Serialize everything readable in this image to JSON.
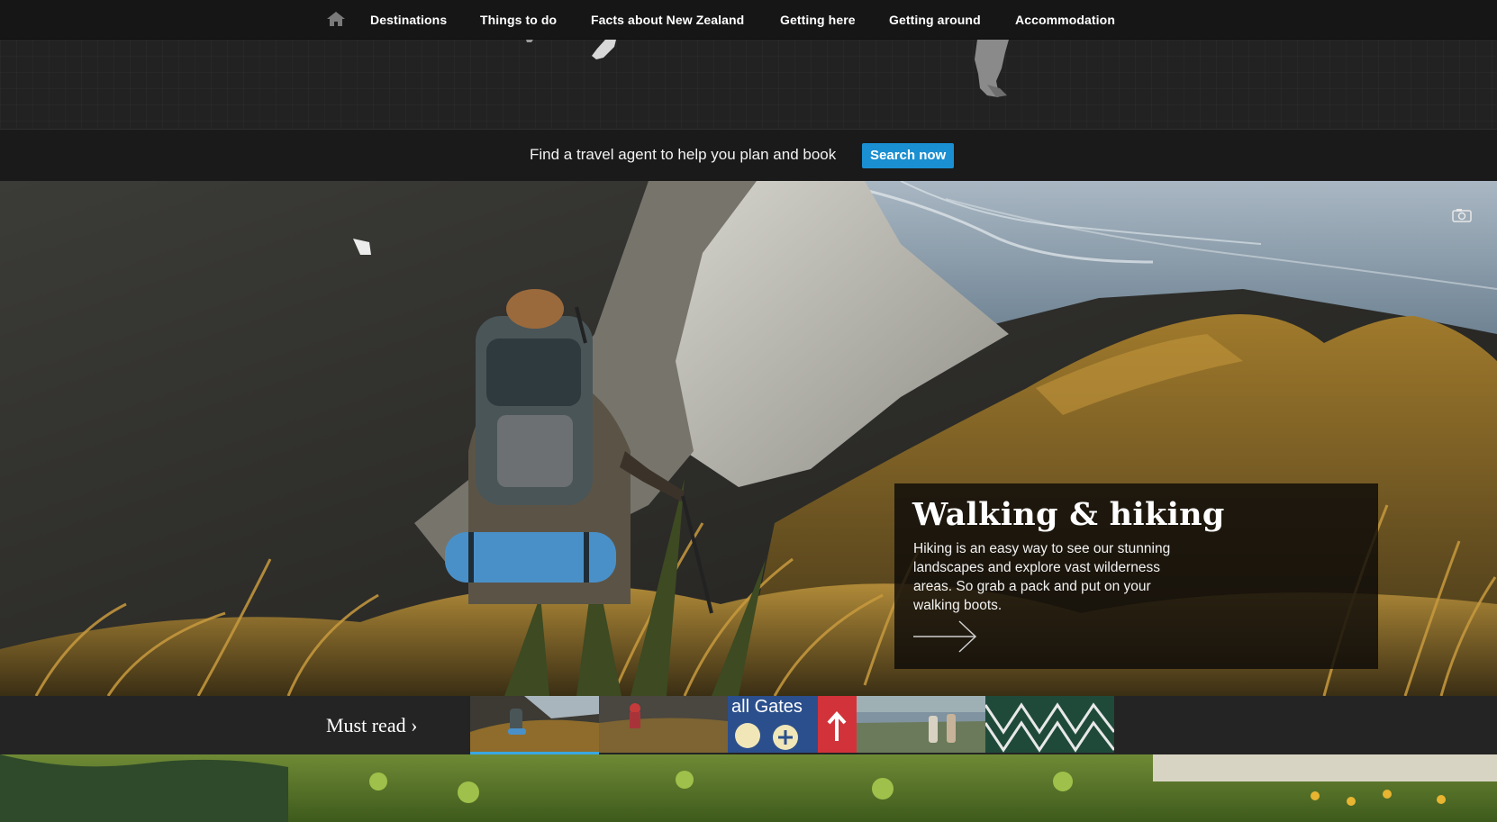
{
  "nav": {
    "items": [
      {
        "label": "Destinations"
      },
      {
        "label": "Things to do"
      },
      {
        "label": "Facts about New Zealand"
      },
      {
        "label": "Getting here"
      },
      {
        "label": "Getting around"
      },
      {
        "label": "Accommodation"
      }
    ]
  },
  "agent_bar": {
    "message": "Find a travel agent to help you plan and book",
    "button_label": "Search now"
  },
  "hero": {
    "title": "Walking & hiking",
    "description": "Hiking is an easy way to see our stunning landscapes and explore vast wilderness areas. So grab a pack and put on your walking boots."
  },
  "must_read": {
    "label": "Must read ›",
    "thumbnails": [
      {
        "scene": "hiker on ridge",
        "active": true
      },
      {
        "scene": "hiker in tussock",
        "active": false
      },
      {
        "scene": "airport sign",
        "text": "all Gates",
        "active": false
      },
      {
        "scene": "walkers by lake",
        "active": false
      },
      {
        "scene": "green pattern",
        "active": false
      }
    ]
  },
  "colors": {
    "accent": "#1a8fd1",
    "active_underline": "#3aa7e0",
    "nav_bg": "#161616"
  }
}
